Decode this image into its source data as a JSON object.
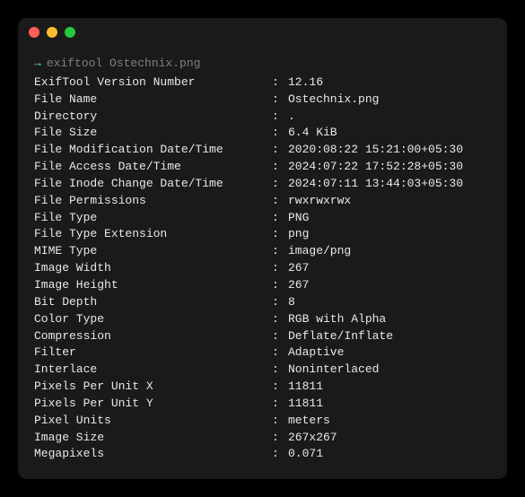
{
  "prompt": {
    "arrow": "→",
    "command": "exiftool Ostechnix.png"
  },
  "output": [
    {
      "label": "ExifTool Version Number",
      "value": "12.16"
    },
    {
      "label": "File Name",
      "value": "Ostechnix.png"
    },
    {
      "label": "Directory",
      "value": "."
    },
    {
      "label": "File Size",
      "value": "6.4 KiB"
    },
    {
      "label": "File Modification Date/Time",
      "value": "2020:08:22 15:21:00+05:30"
    },
    {
      "label": "File Access Date/Time",
      "value": "2024:07:22 17:52:28+05:30"
    },
    {
      "label": "File Inode Change Date/Time",
      "value": "2024:07:11 13:44:03+05:30"
    },
    {
      "label": "File Permissions",
      "value": "rwxrwxrwx"
    },
    {
      "label": "File Type",
      "value": "PNG"
    },
    {
      "label": "File Type Extension",
      "value": "png"
    },
    {
      "label": "MIME Type",
      "value": "image/png"
    },
    {
      "label": "Image Width",
      "value": "267"
    },
    {
      "label": "Image Height",
      "value": "267"
    },
    {
      "label": "Bit Depth",
      "value": "8"
    },
    {
      "label": "Color Type",
      "value": "RGB with Alpha"
    },
    {
      "label": "Compression",
      "value": "Deflate/Inflate"
    },
    {
      "label": "Filter",
      "value": "Adaptive"
    },
    {
      "label": "Interlace",
      "value": "Noninterlaced"
    },
    {
      "label": "Pixels Per Unit X",
      "value": "11811"
    },
    {
      "label": "Pixels Per Unit Y",
      "value": "11811"
    },
    {
      "label": "Pixel Units",
      "value": "meters"
    },
    {
      "label": "Image Size",
      "value": "267x267"
    },
    {
      "label": "Megapixels",
      "value": "0.071"
    }
  ]
}
